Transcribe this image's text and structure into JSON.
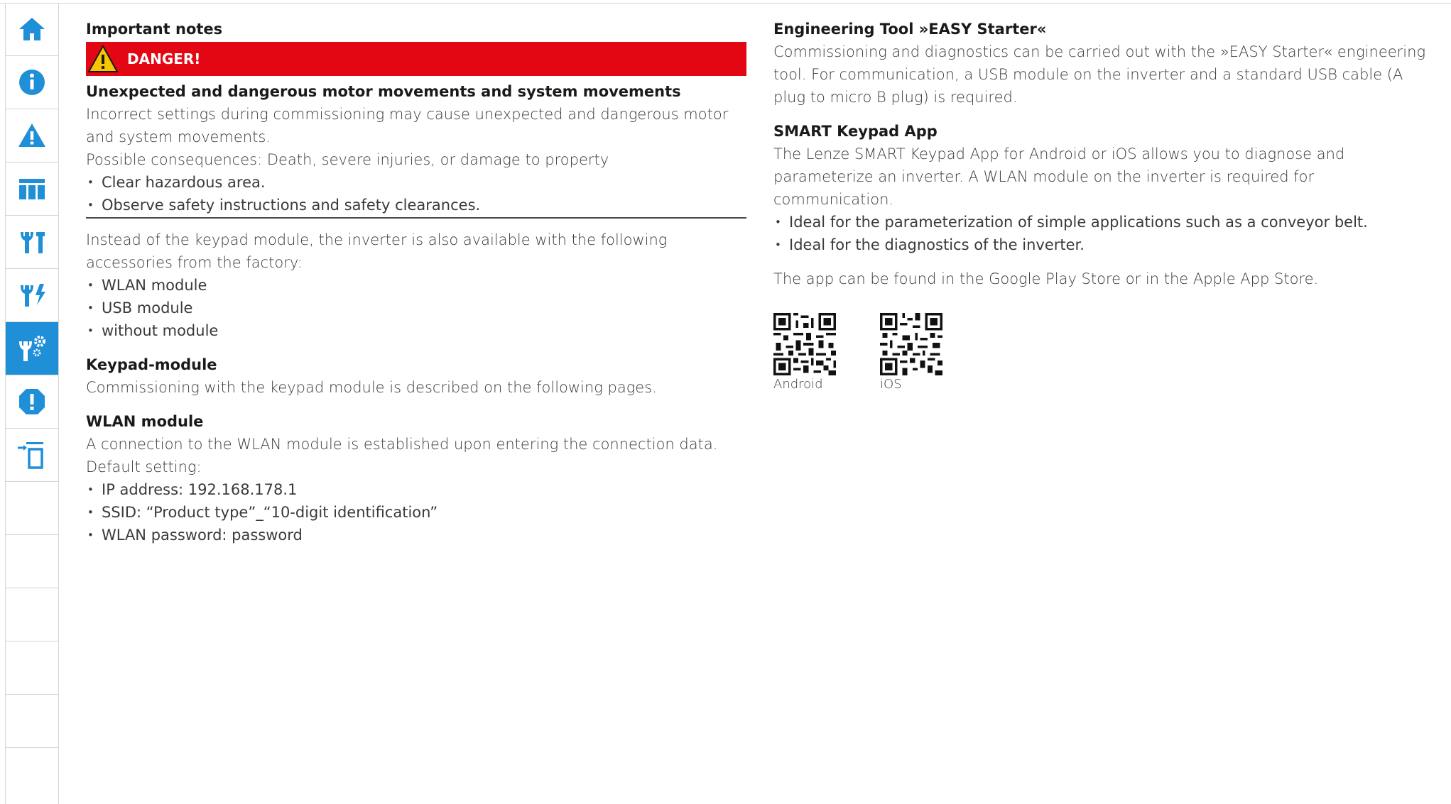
{
  "sidebar": {
    "items": [
      {
        "icon": "home-icon",
        "active": false
      },
      {
        "icon": "info-icon",
        "active": false
      },
      {
        "icon": "warning-icon",
        "active": false
      },
      {
        "icon": "table-icon",
        "active": false
      },
      {
        "icon": "tools-icon",
        "active": false
      },
      {
        "icon": "electrical-tools-icon",
        "active": false
      },
      {
        "icon": "commissioning-icon",
        "active": true
      },
      {
        "icon": "error-icon",
        "active": false
      },
      {
        "icon": "export-icon",
        "active": false
      },
      {
        "icon": "",
        "active": false
      },
      {
        "icon": "",
        "active": false
      },
      {
        "icon": "",
        "active": false
      },
      {
        "icon": "",
        "active": false
      },
      {
        "icon": "",
        "active": false
      }
    ]
  },
  "colors": {
    "accent": "#1f8fd8",
    "danger": "#e30613",
    "warning_yellow": "#f6c400"
  },
  "left": {
    "important_notes_title": "Important notes",
    "danger_label": "DANGER!",
    "danger_heading": "Unexpected and dangerous motor movements and system movements",
    "danger_text": "Incorrect settings during commissioning may cause unexpected and dangerous motor and system movements.",
    "consequences": "Possible consequences: Death, severe injuries, or damage to property",
    "danger_bullets": [
      "Clear hazardous area.",
      "Observe safety instructions and safety clearances."
    ],
    "accessories_intro": "Instead of the keypad module, the inverter is also available with the following accessories from the factory:",
    "accessories": [
      "WLAN module",
      "USB module",
      "without module"
    ],
    "keypad_title": "Keypad-module",
    "keypad_text": "Commissioning with the keypad module is described on the following pages.",
    "wlan_title": "WLAN module",
    "wlan_text": "A connection to the WLAN module is established upon entering the connection data.",
    "default_setting": "Default setting:",
    "wlan_bullets": [
      "IP address: 192.168.178.1",
      "SSID: “Product type”_“10-digit identification”",
      "WLAN password: password"
    ]
  },
  "right": {
    "easy_title": "Engineering Tool »EASY Starter«",
    "easy_text": "Commissioning and diagnostics can be carried out with the »EASY Starter« engineering tool. For communication, a USB module on the inverter and a standard USB cable (A plug to micro B plug) is required.",
    "smart_title": "SMART Keypad App",
    "smart_text": "The Lenze SMART Keypad App for Android or iOS allows you to diagnose and parameterize an inverter. A WLAN module on the inverter is required for communication.",
    "smart_bullets": [
      "Ideal for the parameterization of simple applications such as a conveyor belt.",
      "Ideal for the diagnostics of the inverter."
    ],
    "store_text": "The app can be found in the Google Play Store or in the Apple App Store.",
    "qr_android_label": "Android",
    "qr_ios_label": "iOS"
  }
}
